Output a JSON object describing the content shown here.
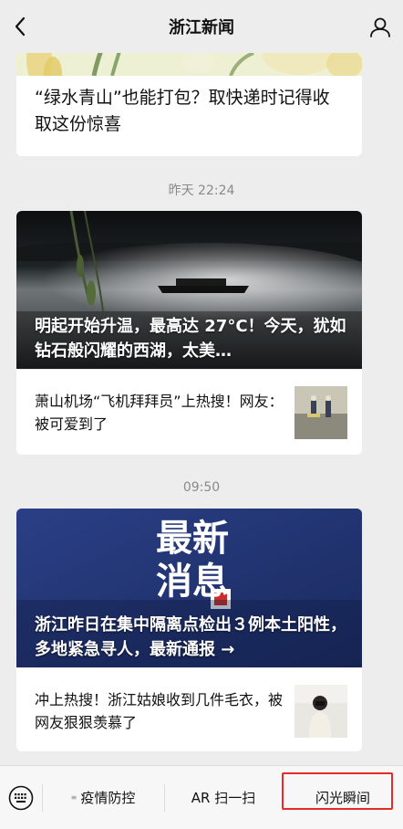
{
  "header": {
    "title": "浙江新闻"
  },
  "feed": {
    "card1": {
      "headline": "“绿水青山”也能打包？取快递时记得收取这份惊喜"
    },
    "time1": "昨天 22:24",
    "card2": {
      "hero_caption": "明起开始升温，最高达 27°C！今天，犹如钻石般闪耀的西湖，太美…",
      "sub_title": "萧山机场“飞机拜拜员”上热搜！网友：被可爱到了"
    },
    "time2": "09:50",
    "card3": {
      "hero_big_1": "最新",
      "hero_big_2": "消息",
      "hero_caption": "浙江昨日在集中隔离点检出３例本土阳性，多地紧急寻人，最新通报 →",
      "sub_title": "冲上热搜！浙江姑娘收到几件毛衣，被网友狠狠羡慕了"
    }
  },
  "bottom_menu": {
    "items": [
      {
        "label": "疫情防控"
      },
      {
        "label": "AR 扫一扫"
      },
      {
        "label": "闪光瞬间"
      }
    ]
  },
  "colors": {
    "highlight": "#e52a2a",
    "hero_blue": "#24397a",
    "background": "#ededed"
  }
}
